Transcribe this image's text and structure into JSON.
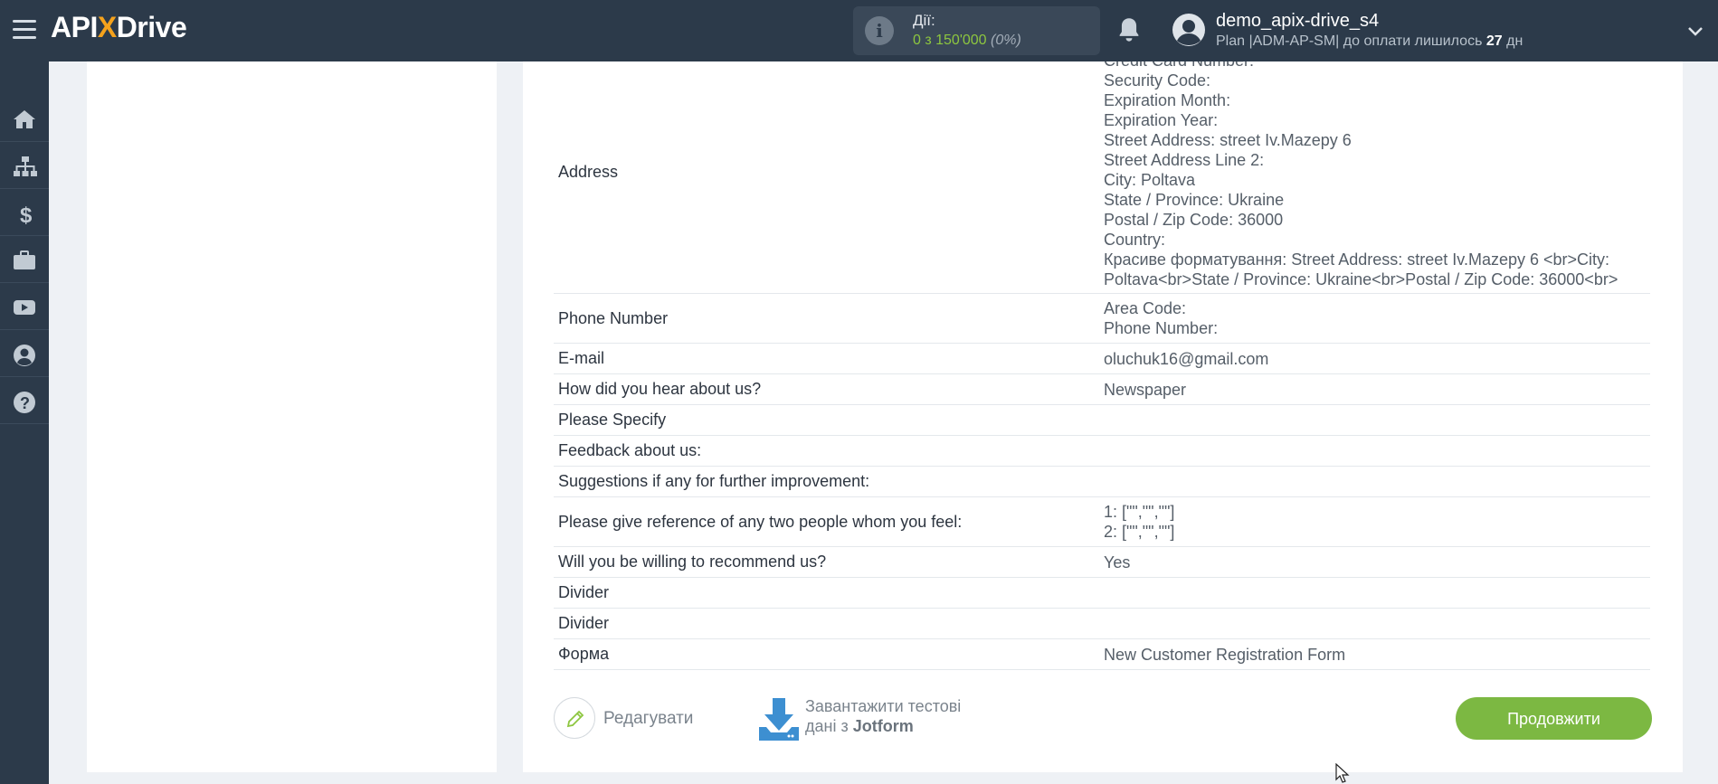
{
  "topbar": {
    "logo_prefix": "API",
    "logo_x": "X",
    "logo_suffix": "Drive",
    "actions_label": "Дії:",
    "actions_count": "0 з 150'000",
    "actions_pct": "(0%)",
    "username": "demo_apix-drive_s4",
    "plan_prefix": "Plan |ADM-AP-SM| до оплати лишилось",
    "plan_days": "27",
    "plan_suffix": "дн"
  },
  "sidebar": {
    "items": [
      "home-icon",
      "sitemap-icon",
      "dollar-icon",
      "briefcase-icon",
      "youtube-icon",
      "user-icon",
      "help-icon"
    ]
  },
  "table": {
    "address": {
      "label": "Address",
      "lines": [
        "Credit Card Number:",
        "Security Code:",
        "Expiration Month:",
        "Expiration Year:",
        "Street Address: street Iv.Mazepy 6",
        "Street Address Line 2:",
        "City: Poltava",
        "State / Province: Ukraine",
        "Postal / Zip Code: 36000",
        "Country:",
        "Красиве форматування: Street Address: street Iv.Mazepy 6 <br>City:",
        "Poltava<br>State / Province: Ukraine<br>Postal / Zip Code: 36000<br>"
      ]
    },
    "phone": {
      "label": "Phone Number",
      "lines": [
        "Area Code:",
        "Phone Number:"
      ]
    },
    "rows": [
      {
        "label": "E-mail",
        "value": "oluchuk16@gmail.com"
      },
      {
        "label": "How did you hear about us?",
        "value": "Newspaper"
      },
      {
        "label": "Please Specify",
        "value": ""
      },
      {
        "label": "Feedback about us:",
        "value": ""
      },
      {
        "label": "Suggestions if any for further improvement:",
        "value": ""
      }
    ],
    "reference": {
      "label": "Please give reference of any two people whom you feel:",
      "lines": [
        "1: [\"\",\"\",\"\"]",
        "2: [\"\",\"\",\"\"]"
      ]
    },
    "rows2": [
      {
        "label": "Will you be willing to recommend us?",
        "value": "Yes"
      },
      {
        "label": "Divider",
        "value": ""
      },
      {
        "label": "Divider",
        "value": ""
      },
      {
        "label": "Форма",
        "value": "New Customer Registration Form"
      }
    ]
  },
  "buttons": {
    "edit": "Редагувати",
    "load_line1": "Завантажити тестові",
    "load_line2_prefix": "дані з",
    "load_line2_source": "Jotform",
    "continue": "Продовжити"
  },
  "colors": {
    "topbar_bg": "#2c3a4a",
    "accent_green": "#7cb842",
    "logo_accent": "#f5a21c",
    "download_blue": "#3d8fd1"
  }
}
